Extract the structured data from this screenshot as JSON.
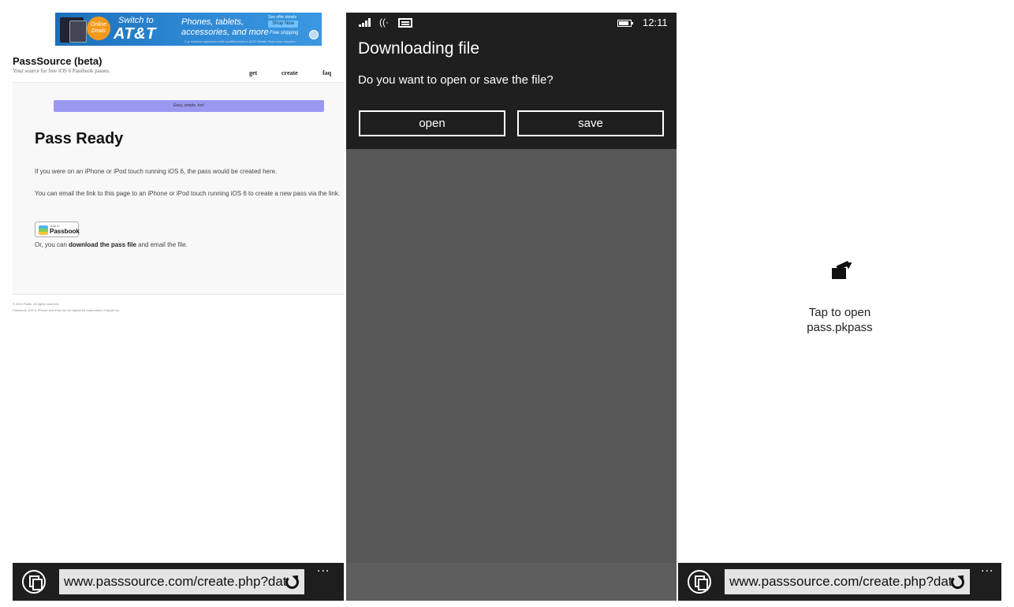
{
  "left_panel": {
    "ad": {
      "badge": "Online Deals",
      "switch_to": "Switch to",
      "brand": "AT&T",
      "line1": "Phones, tablets,",
      "line2": "accessories, and more",
      "small_top": "See offer details",
      "shop_now": "Shop Now",
      "free_shipping": "Free shipping",
      "disclaimer": "2-yr wireless agreement with qualified data or AT&T Mobile Share plan required."
    },
    "site": {
      "title": "PassSource (beta)",
      "subtitle": "Your source for free iOS 6 Passbook passes.",
      "nav": [
        "get",
        "create",
        "faq"
      ]
    },
    "content": {
      "tagline": "Easy, simple, fun!",
      "heading": "Pass Ready",
      "para1": "If you were on an iPhone or iPod touch running iOS 6, the pass would be created here.",
      "para2": "You can email the link to this page to an iPhone or iPod touch running iOS 6 to create a new pass via the link.",
      "passbook_small": "Add to",
      "passbook_label": "Passbook",
      "para3_prefix": "Or, you can ",
      "para3_link": "download the pass file",
      "para3_suffix": " and email the file."
    },
    "footer": {
      "line1": "© 2013 Rodik. All rights reserved.",
      "line2": "Passbook, iOS 6, iPhone and iPad are all registered trademarks of Apple Inc."
    },
    "address_bar": {
      "url": "www.passsource.com/create.php?dat",
      "more": "..."
    }
  },
  "middle_panel": {
    "status": {
      "time": "12:11",
      "wifi": "((·"
    },
    "dialog": {
      "title": "Downloading file",
      "message": "Do you want to open or save the file?",
      "open_label": "open",
      "save_label": "save"
    }
  },
  "right_panel": {
    "tap_line1": "Tap to open",
    "tap_line2": "pass.pkpass",
    "address_bar": {
      "url": "www.passsource.com/create.php?dat",
      "more": "..."
    }
  },
  "icons": {
    "tabs": "tabs-icon",
    "refresh": "refresh-icon",
    "more": "more-icon",
    "signal": "signal-icon",
    "wifi": "wifi-icon",
    "message": "message-icon",
    "battery": "battery-icon",
    "open_file": "open-file-icon"
  },
  "colors": {
    "dialog_bg": "#1f1f1f",
    "overlay_bg": "#575757",
    "appbar_bg": "#1e1e1e",
    "tagline_bar": "#9b98f2",
    "att_blue": "#1b6fb8"
  }
}
